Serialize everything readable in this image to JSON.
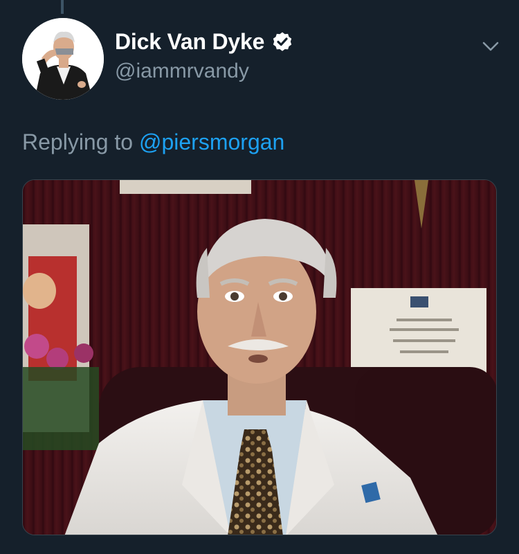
{
  "tweet": {
    "display_name": "Dick Van Dyke",
    "handle": "@iammrvandy",
    "verified": true,
    "reply_prefix": "Replying to",
    "reply_to": "@piersmorgan"
  },
  "icons": {
    "verified": "verified-badge-icon",
    "caret": "chevron-down-icon"
  },
  "colors": {
    "background": "#15202b",
    "primary_text": "#ffffff",
    "secondary_text": "#8899a6",
    "link": "#1da1f2"
  }
}
